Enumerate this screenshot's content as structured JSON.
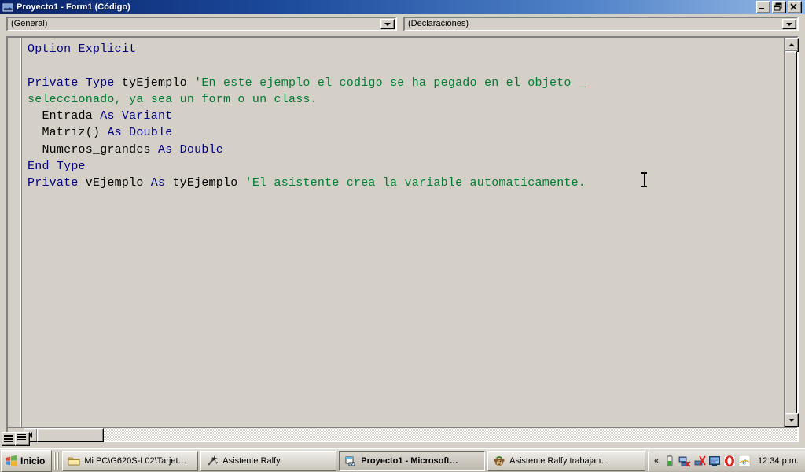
{
  "window": {
    "title": "Proyecto1 - Form1 (Código)",
    "icon": "vb-code-module-icon",
    "buttons": {
      "minimize": "Minimizar",
      "restore": "Restaurar",
      "close": "Cerrar"
    }
  },
  "toolbars": {
    "object_combo": {
      "name": "object-combo",
      "value": "(General)",
      "arrow_icon": "chevron-down-icon"
    },
    "procedure_combo": {
      "name": "procedure-combo",
      "value": "(Declaraciones)",
      "arrow_icon": "chevron-down-icon"
    }
  },
  "code": {
    "language": "Visual Basic 6",
    "colors": {
      "keyword": "#00007f",
      "comment": "#007d32",
      "identifier": "#000000",
      "background": "#d4d0c8"
    },
    "lines": [
      [
        {
          "t": "Option Explicit",
          "c": "kw"
        }
      ],
      [
        {
          "t": "",
          "c": "id"
        }
      ],
      [
        {
          "t": "Private Type ",
          "c": "kw"
        },
        {
          "t": "tyEjemplo ",
          "c": "id"
        },
        {
          "t": "'En este ejemplo el codigo se ha pegado en el objeto _",
          "c": "cmt"
        }
      ],
      [
        {
          "t": "seleccionado, ya sea un form o un class.",
          "c": "cmt"
        }
      ],
      [
        {
          "t": "  Entrada ",
          "c": "id"
        },
        {
          "t": "As Variant",
          "c": "kw"
        }
      ],
      [
        {
          "t": "  Matriz() ",
          "c": "id"
        },
        {
          "t": "As Double",
          "c": "kw"
        }
      ],
      [
        {
          "t": "  Numeros_grandes ",
          "c": "id"
        },
        {
          "t": "As Double",
          "c": "kw"
        }
      ],
      [
        {
          "t": "End Type",
          "c": "kw"
        }
      ],
      [
        {
          "t": "Private ",
          "c": "kw"
        },
        {
          "t": "vEjemplo ",
          "c": "id"
        },
        {
          "t": "As ",
          "c": "kw"
        },
        {
          "t": "tyEjemplo ",
          "c": "id"
        },
        {
          "t": "'El asistente crea la variable automaticamente.",
          "c": "cmt"
        }
      ]
    ]
  },
  "scrollbars": {
    "vertical": {
      "up_icon": "scroll-up-arrow-icon",
      "down_icon": "scroll-down-arrow-icon"
    },
    "horizontal": {
      "left_icon": "scroll-left-arrow-icon",
      "right_icon": "scroll-right-arrow-icon"
    }
  },
  "view_buttons": {
    "procedure_view": "procedure-view-icon",
    "full_module_view": "full-module-view-icon"
  },
  "taskbar": {
    "start": {
      "label": "Inicio",
      "icon": "windows-flag-icon"
    },
    "tasks": [
      {
        "label": "Mi PC\\G620S-L02\\Tarjet…",
        "icon": "folder-icon",
        "active": false
      },
      {
        "label": "Asistente Ralfy",
        "icon": "wand-icon",
        "active": false
      },
      {
        "label": "Proyecto1 - Microsoft…",
        "icon": "visual-basic-icon",
        "active": true
      },
      {
        "label": "Asistente Ralfy trabajan…",
        "icon": "monkey-icon",
        "active": false
      }
    ],
    "tray": {
      "expand_icon": "chevron-left-double-icon",
      "expand_label": "«",
      "icons": [
        "battery-icon",
        "network-disconnected-icon",
        "wireless-disconnected-icon",
        "display-settings-icon",
        "opera-icon",
        "internet-explorer-icon"
      ],
      "clock": "12:34 p.m."
    }
  }
}
